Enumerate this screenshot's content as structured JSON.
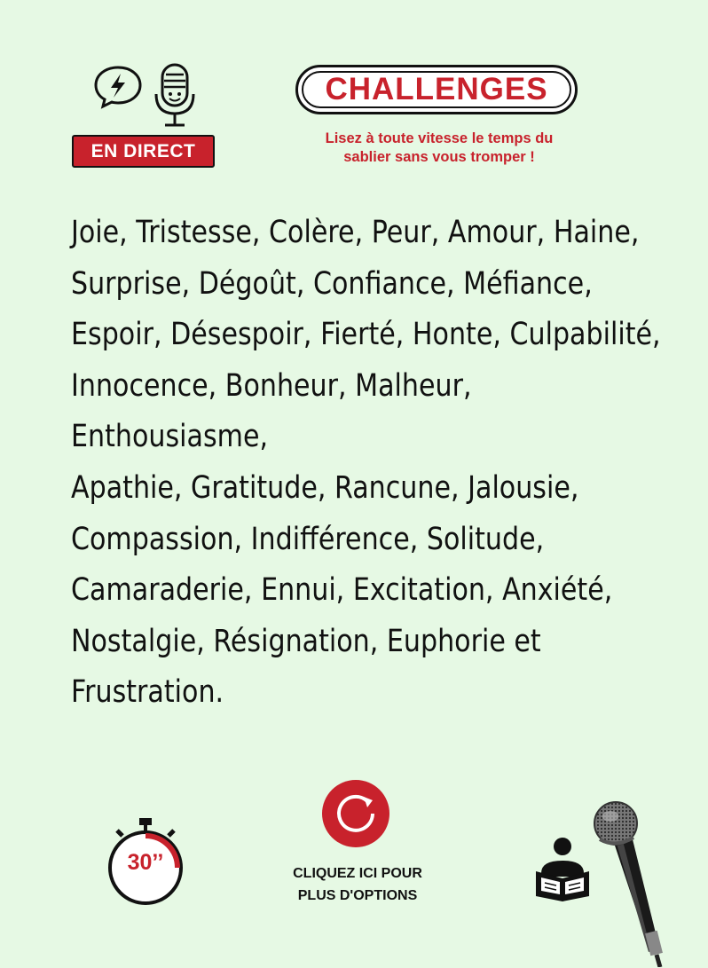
{
  "header": {
    "live_label": "EN DIRECT",
    "title": "CHALLENGES",
    "subtitle_line1": "Lisez à toute vitesse le temps du",
    "subtitle_line2": "sablier sans vous tromper !"
  },
  "content": {
    "lines": [
      "Joie, Tristesse, Colère, Peur, Amour, Haine,",
      "Surprise, Dégoût, Confiance, Méfiance,",
      "Espoir, Désespoir, Fierté, Honte, Culpabilité,",
      "Innocence, Bonheur, Malheur, Enthousiasme,",
      "Apathie, Gratitude, Rancune, Jalousie,",
      "Compassion, Indifférence, Solitude,",
      "Camaraderie, Ennui, Excitation, Anxiété,",
      "Nostalgie, Résignation, Euphorie et",
      "Frustration."
    ]
  },
  "footer": {
    "timer_label": "30’’",
    "options_line1": "CLIQUEZ ICI POUR",
    "options_line2": "PLUS D'OPTIONS"
  },
  "icons": {
    "speech": "speech-bubble-lightning-icon",
    "podcast_mic": "podcast-microphone-icon",
    "refresh": "refresh-icon",
    "timer": "stopwatch-icon",
    "reader": "reader-icon",
    "microphone": "handheld-microphone-icon"
  },
  "colors": {
    "background": "#e6f9e4",
    "accent": "#c8222c",
    "text": "#111111"
  }
}
